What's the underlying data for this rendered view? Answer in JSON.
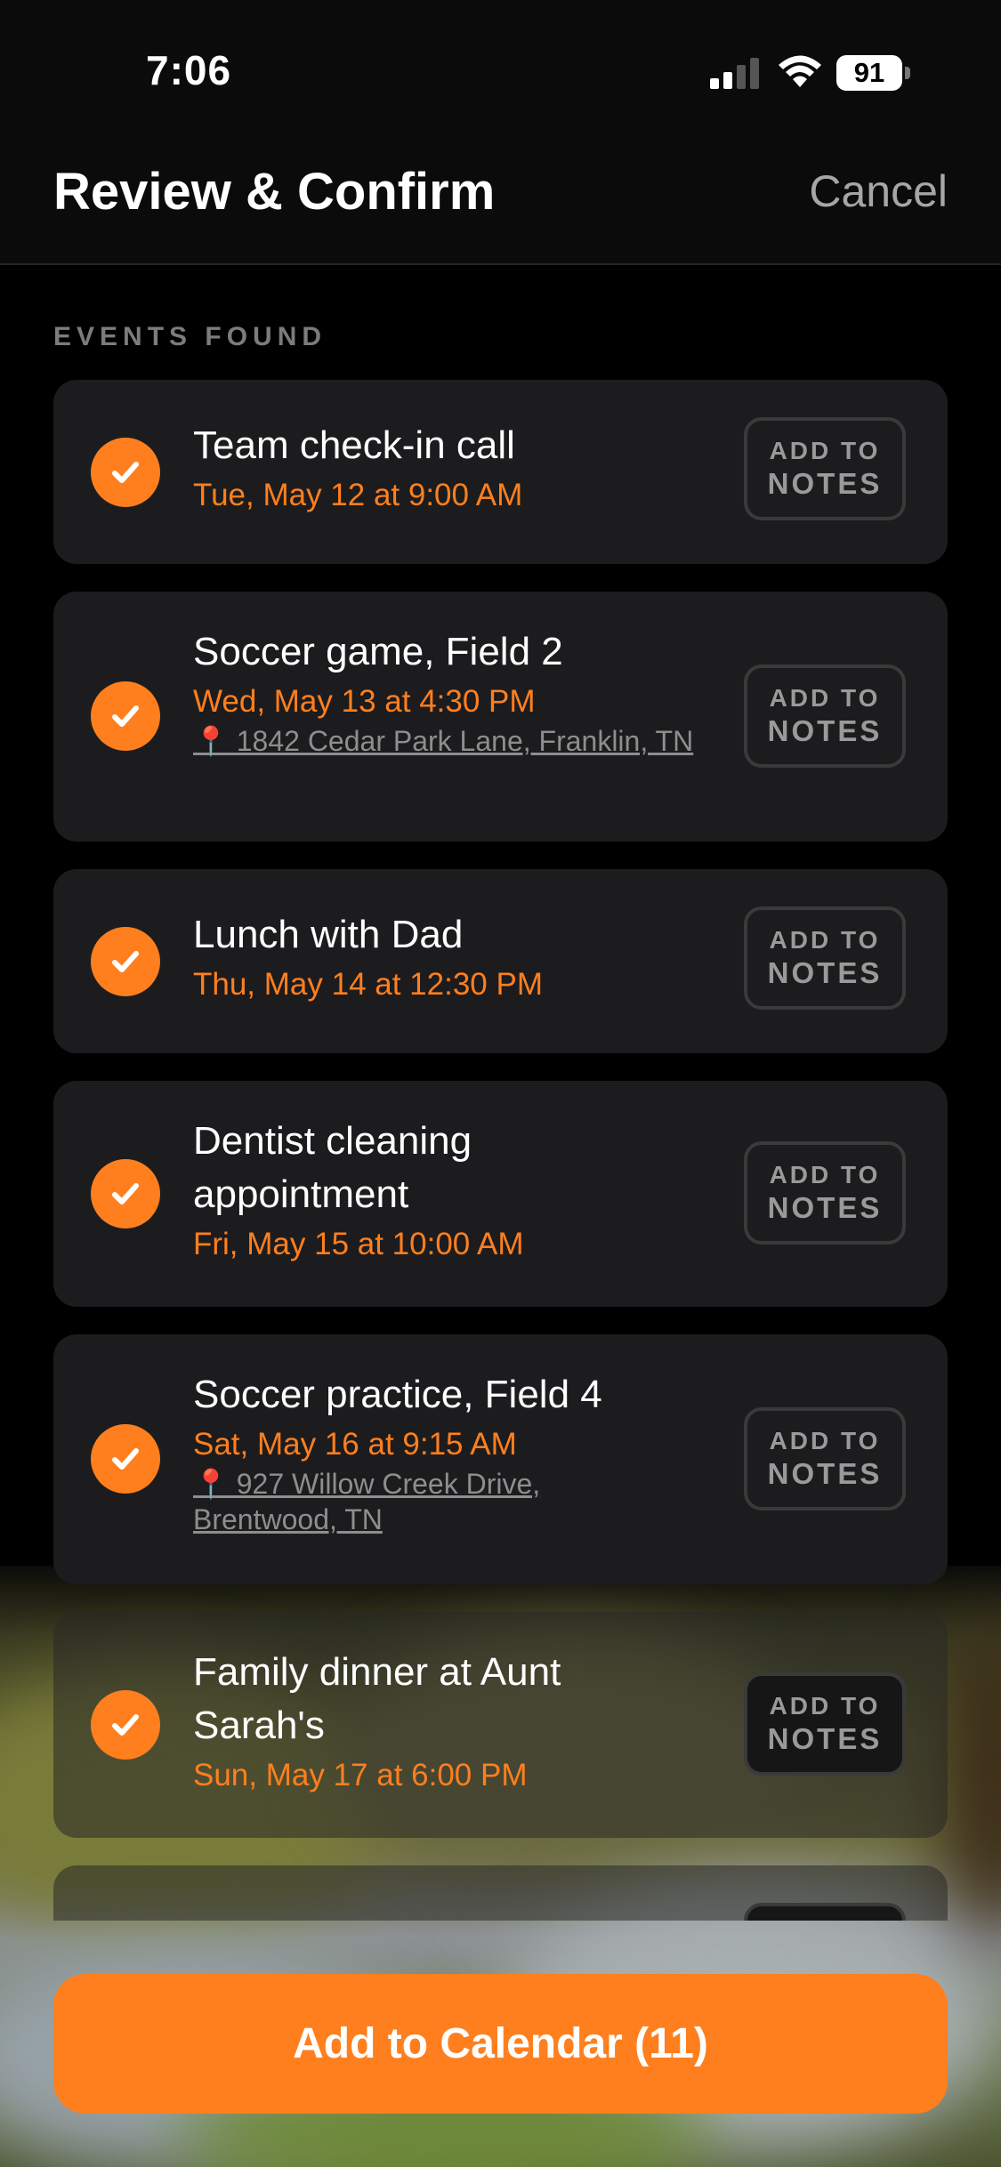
{
  "status_bar": {
    "time": "7:06",
    "battery": "91"
  },
  "nav": {
    "title": "Review & Confirm",
    "cancel_label": "Cancel"
  },
  "section_label": "EVENTS FOUND",
  "notes_button": {
    "top": "ADD TO",
    "bottom": "NOTES"
  },
  "events": [
    {
      "title": "Team check-in call",
      "date": "Tue, May 12 at 9:00 AM",
      "location": "",
      "checked": true
    },
    {
      "title": "Soccer game, Field 2",
      "date": "Wed, May 13 at 4:30 PM",
      "location": "📍 1842 Cedar Park Lane, Franklin, TN",
      "checked": true
    },
    {
      "title": "Lunch with Dad",
      "date": "Thu, May 14 at 12:30 PM",
      "location": "",
      "checked": true
    },
    {
      "title": "Dentist cleaning appointment",
      "date": "Fri, May 15 at 10:00 AM",
      "location": "",
      "checked": true
    },
    {
      "title": "Soccer practice, Field 4",
      "date": "Sat, May 16 at 9:15 AM",
      "location": "📍 927 Willow Creek Drive, Brentwood, TN",
      "checked": true
    },
    {
      "title": "Family dinner at Aunt Sarah's",
      "date": "Sun, May 17 at 6:00 PM",
      "location": "",
      "checked": true
    }
  ],
  "cta_label": "Add to Calendar (11)",
  "colors": {
    "accent": "#ff7f1e",
    "card": "#1c1c1e",
    "background": "#000000"
  }
}
